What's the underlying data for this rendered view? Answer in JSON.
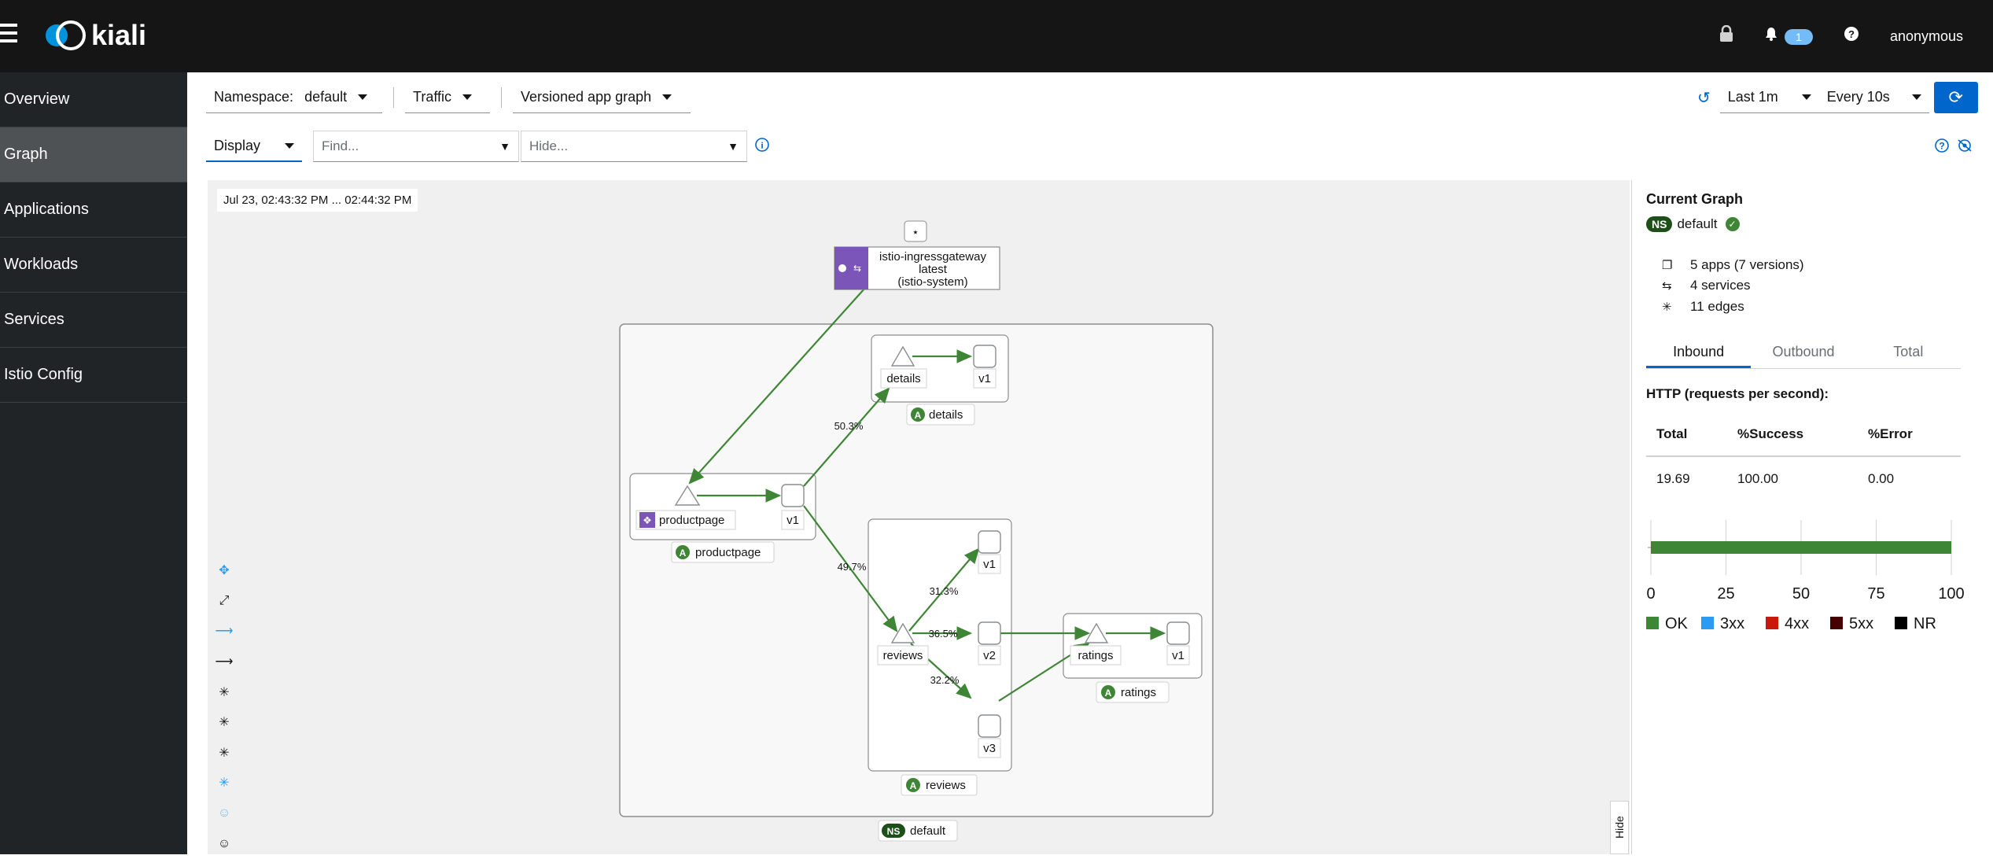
{
  "header": {
    "logo_text": "kiali",
    "notification_count": "1",
    "username": "anonymous",
    "icons": [
      "menu-icon",
      "lock-icon",
      "bell-icon",
      "help-icon"
    ]
  },
  "sidebar": {
    "items": [
      {
        "label": "Overview",
        "active": false
      },
      {
        "label": "Graph",
        "active": true
      },
      {
        "label": "Applications",
        "active": false
      },
      {
        "label": "Workloads",
        "active": false
      },
      {
        "label": "Services",
        "active": false
      },
      {
        "label": "Istio Config",
        "active": false
      }
    ]
  },
  "toolbar": {
    "namespace_label": "Namespace:",
    "namespace_value": "default",
    "traffic_label": "Traffic",
    "graph_type": "Versioned app graph",
    "time_range": "Last 1m",
    "refresh_interval": "Every 10s",
    "display_label": "Display",
    "find_placeholder": "Find...",
    "hide_placeholder": "Hide..."
  },
  "graph": {
    "timestamp": "Jul 23, 02:43:32 PM ... 02:44:32 PM",
    "ingress": {
      "name": "istio-ingressgateway",
      "version": "latest",
      "namespace": "(istio-system)"
    },
    "namespace_box": "default",
    "apps": {
      "productpage": "productpage",
      "details": "details",
      "reviews": "reviews",
      "ratings": "ratings"
    },
    "nodes": {
      "productpage_svc": "productpage",
      "productpage_v1": "v1",
      "details_svc": "details",
      "details_v1": "v1",
      "reviews_svc": "reviews",
      "reviews_v1": "v1",
      "reviews_v2": "v2",
      "reviews_v3": "v3",
      "ratings_svc": "ratings",
      "ratings_v1": "v1"
    },
    "edge_labels": {
      "to_details": "50.3%",
      "to_reviews": "49.7%",
      "to_reviews_v1": "31.3%",
      "to_reviews_v2": "36.5%",
      "to_reviews_v3": "32.2%"
    },
    "ns_badge": "NS",
    "app_badge": "A",
    "edge_color": "#3e8635",
    "ingress_color": "#7b55b8"
  },
  "panel": {
    "title": "Current Graph",
    "namespace": "default",
    "apps": "5 apps (7 versions)",
    "services": "4 services",
    "edges": "11 edges",
    "tabs": [
      "Inbound",
      "Outbound",
      "Total"
    ],
    "http_title": "HTTP (requests per second):",
    "columns": [
      "Total",
      "%Success",
      "%Error"
    ],
    "values": [
      "19.69",
      "100.00",
      "0.00"
    ],
    "chart_ticks": [
      "0",
      "25",
      "50",
      "75",
      "100"
    ],
    "legend": [
      {
        "label": "OK",
        "color": "#3e8635"
      },
      {
        "label": "3xx",
        "color": "#2b9af3"
      },
      {
        "label": "4xx",
        "color": "#c9190b"
      },
      {
        "label": "5xx",
        "color": "#470000"
      },
      {
        "label": "NR",
        "color": "#000000"
      }
    ],
    "hide_label": "Hide"
  },
  "chart_data": {
    "type": "bar",
    "categories": [
      "HTTP"
    ],
    "series": [
      {
        "name": "OK",
        "values": [
          100
        ]
      },
      {
        "name": "3xx",
        "values": [
          0
        ]
      },
      {
        "name": "4xx",
        "values": [
          0
        ]
      },
      {
        "name": "5xx",
        "values": [
          0
        ]
      },
      {
        "name": "NR",
        "values": [
          0
        ]
      }
    ],
    "xlim": [
      0,
      100
    ],
    "orientation": "horizontal",
    "stacked": true
  }
}
